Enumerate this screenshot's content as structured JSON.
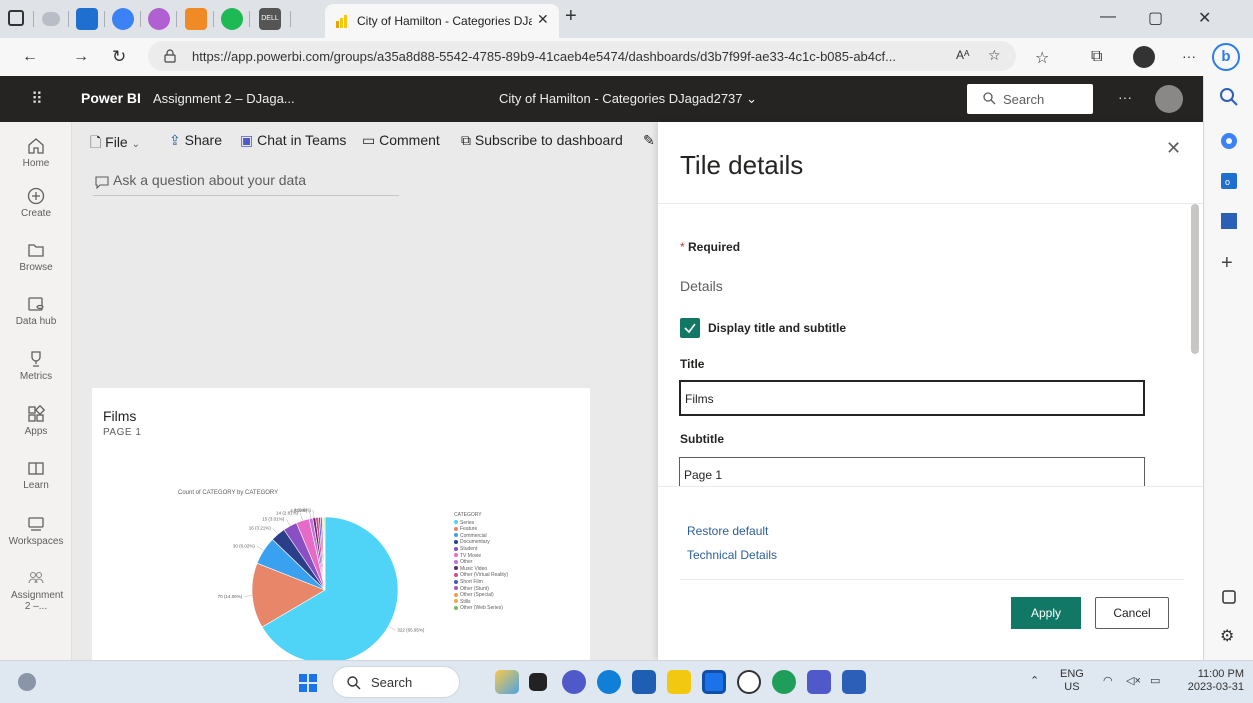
{
  "browser": {
    "tab_title": "City of Hamilton - Categories DJaga",
    "url": "https://app.powerbi.com/groups/a35a8d88-5542-4785-89b9-41caeb4e5474/dashboards/d3b7f99f-ae33-4c1c-b085-ab4cf...",
    "reader_label": "Aᴬ",
    "pinned_label": "DELL"
  },
  "header": {
    "brand": "Power BI",
    "workspace": "Assignment 2 – DJaga...",
    "dashboard_title": "City of Hamilton - Categories DJagad2737",
    "search_placeholder": "Search",
    "more": "···"
  },
  "nav": {
    "items": [
      {
        "label": "Home"
      },
      {
        "label": "Create"
      },
      {
        "label": "Browse"
      },
      {
        "label": "Data hub"
      },
      {
        "label": "Metrics"
      },
      {
        "label": "Apps"
      },
      {
        "label": "Learn"
      },
      {
        "label": "Workspaces"
      },
      {
        "label": "Assignment 2 –..."
      }
    ]
  },
  "toolbar": {
    "file": "File",
    "share": "Share",
    "chat": "Chat in Teams",
    "comment": "Comment",
    "subscribe": "Subscribe to dashboard"
  },
  "qna": {
    "placeholder": "Ask a question about your data"
  },
  "tile": {
    "title": "Films",
    "subtitle": "PAGE 1"
  },
  "chart_data": {
    "type": "pie",
    "title": "Count of CATEGORY by CATEGORY",
    "legend_title": "CATEGORY",
    "legend_position": "right",
    "categories": [
      "Series",
      "Feature",
      "Commercial",
      "Documentary",
      "Student",
      "TV Movie",
      "Other",
      "Music Video",
      "Other (Virtual Reality)",
      "Short Film",
      "Other (Stunt)",
      "Other (Special)",
      "Stills",
      "Other (Web Series)"
    ],
    "values": [
      322,
      70,
      30,
      16,
      15,
      14,
      4,
      3,
      3,
      2,
      2,
      1,
      1,
      1
    ],
    "colors": [
      "#4fd3f7",
      "#e8866a",
      "#3aa0f0",
      "#2c3e8a",
      "#8b4fc4",
      "#e66bc6",
      "#c76fd8",
      "#5a2d6e",
      "#d9478d",
      "#4b5ab3",
      "#a45bb8",
      "#e3a343",
      "#f0a84a",
      "#7fb85c"
    ],
    "labels": [
      "322 (65.95%)",
      "70 (14.06%)",
      "30 (6.02%)",
      "16 (3.21%)",
      "15 (3.01%)",
      "14 (2.81%)",
      "4 (0.8%)",
      "4 (0.8%)"
    ]
  },
  "panel": {
    "title": "Tile details",
    "required": "Required",
    "section": "Details",
    "checkbox_label": "Display title and subtitle",
    "title_label": "Title",
    "title_value": "Films",
    "subtitle_label": "Subtitle",
    "subtitle_value": "Page 1",
    "restore": "Restore default",
    "technical": "Technical Details",
    "apply": "Apply",
    "cancel": "Cancel"
  },
  "taskbar": {
    "search": "Search",
    "lang": "ENG",
    "region": "US",
    "time": "11:00 PM",
    "date": "2023-03-31"
  }
}
